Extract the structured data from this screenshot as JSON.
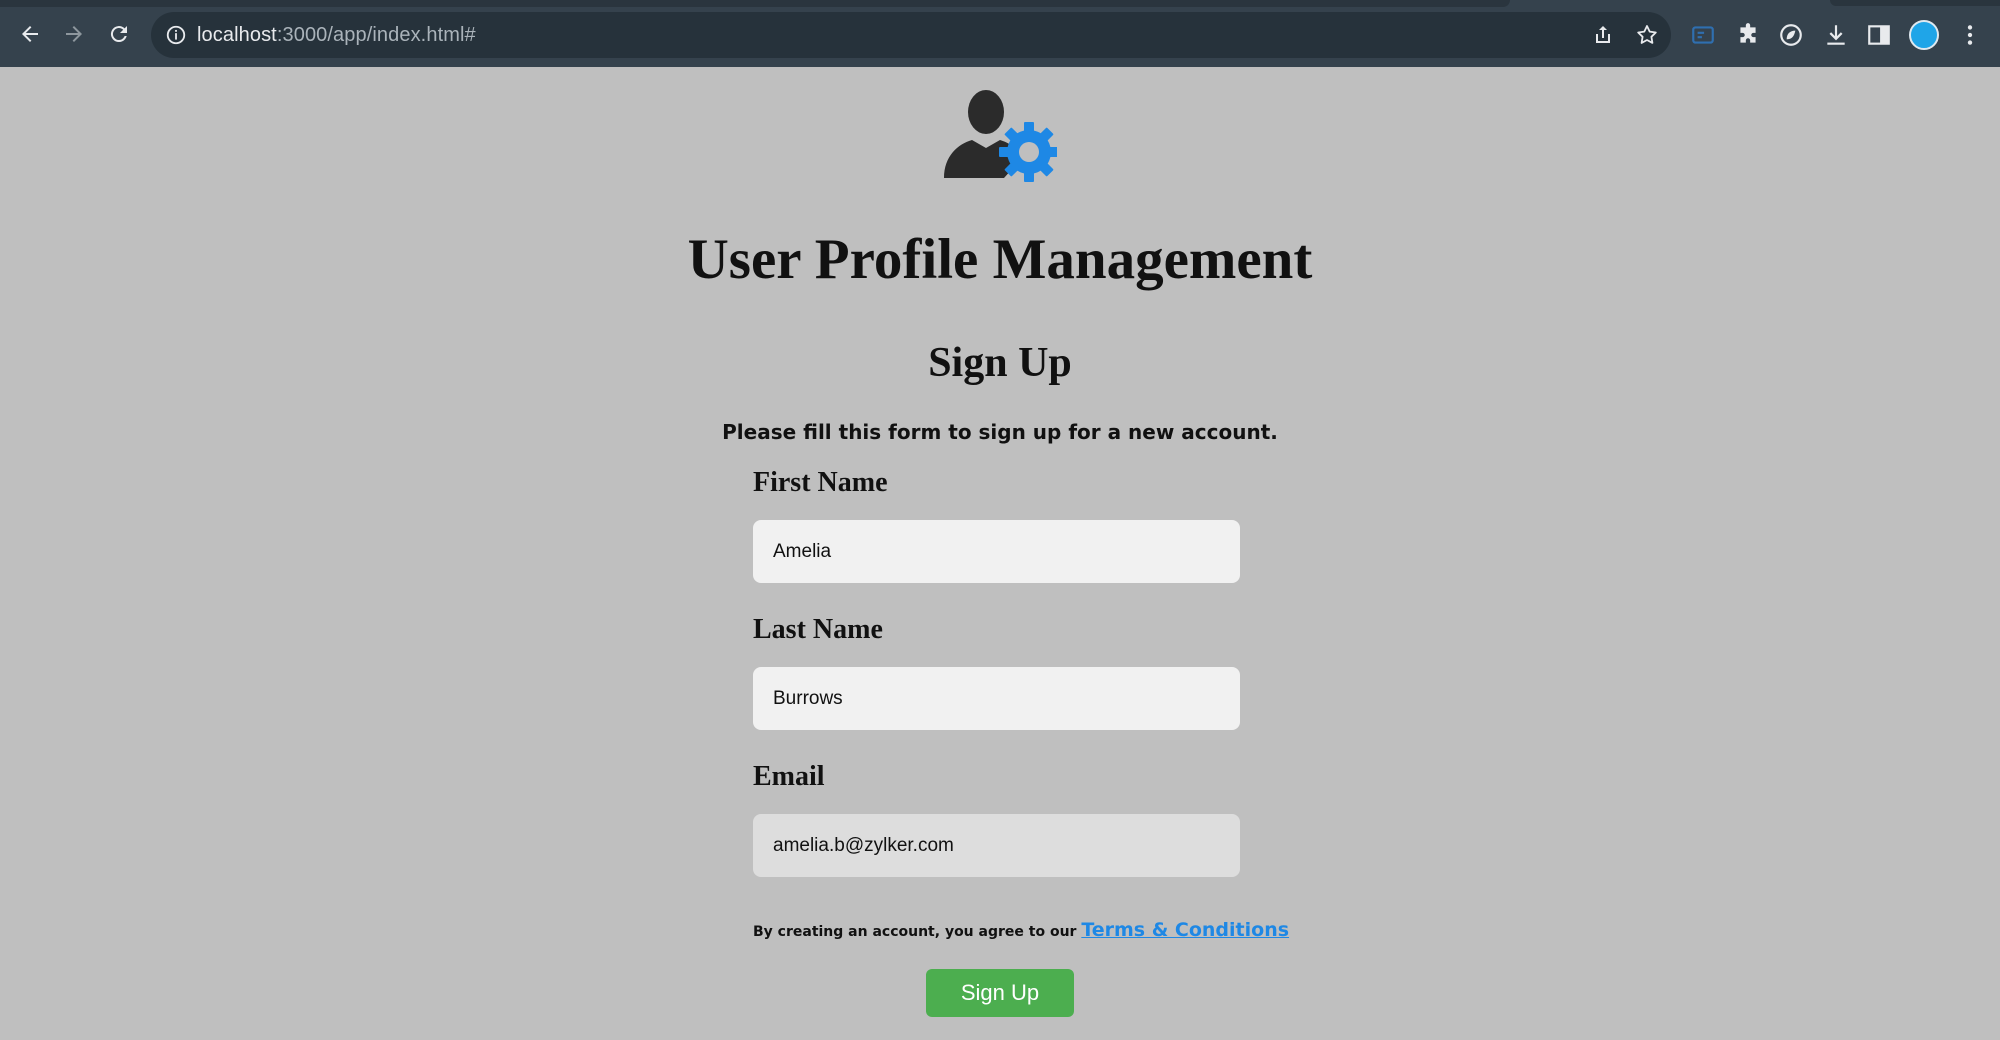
{
  "browser": {
    "url_host": "localhost",
    "url_rest": ":3000/app/index.html#",
    "profile_color": "#1fa5e8"
  },
  "page": {
    "logo_icon": "user-gear-icon",
    "title": "User Profile Management",
    "subtitle": "Sign Up",
    "description": "Please fill this form to sign up for a new account.",
    "form": {
      "first_name": {
        "label": "First Name",
        "value": "Amelia"
      },
      "last_name": {
        "label": "Last Name",
        "value": "Burrows"
      },
      "email": {
        "label": "Email",
        "value": "amelia.b@zylker.com"
      }
    },
    "terms_text": "By creating an account, you agree to our",
    "terms_link": "Terms & Conditions",
    "submit_label": "Sign Up"
  },
  "colors": {
    "background": "#bfbfbf",
    "accent_blue": "#1e88e5",
    "button_green": "#4cae4f"
  }
}
